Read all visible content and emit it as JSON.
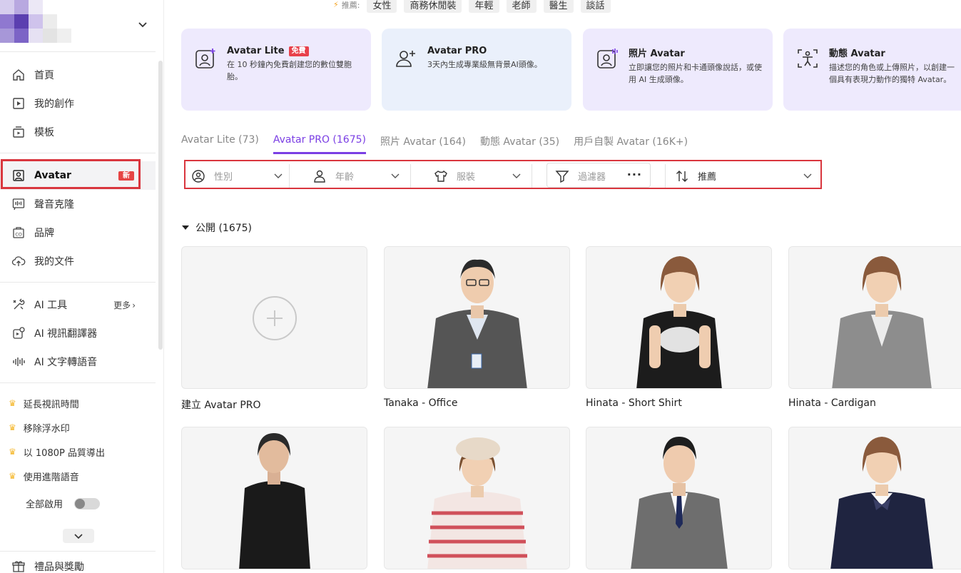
{
  "sidebar": {
    "nav": [
      {
        "label": "首頁"
      },
      {
        "label": "我的創作"
      },
      {
        "label": "模板"
      }
    ],
    "avatar_item": {
      "label": "Avatar",
      "badge": "新"
    },
    "nav2": [
      {
        "label": "聲音克隆"
      },
      {
        "label": "品牌"
      },
      {
        "label": "我的文件"
      }
    ],
    "ai_tools": {
      "label": "AI 工具",
      "more": "更多"
    },
    "ai_items": [
      {
        "label": "AI 視訊翻譯器"
      },
      {
        "label": "AI 文字轉語音"
      }
    ],
    "premium": [
      {
        "label": "延長視訊時間"
      },
      {
        "label": "移除浮水印"
      },
      {
        "label": "以 1080P 品質導出"
      },
      {
        "label": "使用進階語音"
      }
    ],
    "enable_all": "全部啟用",
    "rewards": "禮品與獎勵"
  },
  "recommend": {
    "label": "推薦:",
    "chips": [
      "女性",
      "商務休閒裝",
      "年輕",
      "老師",
      "醫生",
      "談話"
    ]
  },
  "cards": [
    {
      "title": "Avatar Lite",
      "badge": "免費",
      "desc": "在 10 秒鐘內免費創建您的數位雙胞胎。"
    },
    {
      "title": "Avatar PRO",
      "desc": "3天內生成專業級無背景AI頭像。"
    },
    {
      "title": "照片 Avatar",
      "desc": "立即讓您的照片和卡通頭像說話，或使用 AI 生成頭像。"
    },
    {
      "title": "動態 Avatar",
      "desc": "描述您的角色或上傳照片，以創建一個具有表現力動作的獨特 Avatar。"
    }
  ],
  "tabs": [
    {
      "label": "Avatar Lite (73)"
    },
    {
      "label": "Avatar PRO (1675)",
      "active": true
    },
    {
      "label": "照片 Avatar (164)"
    },
    {
      "label": "動態 Avatar (35)"
    },
    {
      "label": "用戶自製 Avatar (16K+)"
    }
  ],
  "filters": {
    "gender": "性別",
    "age": "年齡",
    "outfit": "服裝",
    "filter": "過濾器",
    "sort": "推薦"
  },
  "section": {
    "label": "公開 (1675)"
  },
  "avatars_row1": [
    {
      "label": "建立 Avatar PRO"
    },
    {
      "label": "Tanaka - Office",
      "shirt": "#4a4a4a",
      "hair": "#2b2b2b"
    },
    {
      "label": "Hinata - Short Shirt",
      "shirt": "#1c1c1c",
      "hair": "#8a5a3c"
    },
    {
      "label": "Hinata - Cardigan",
      "shirt": "#8d8d8d",
      "hair": "#8a5a3c"
    }
  ],
  "avatars_row2": [
    {
      "shirt": "#1a1a1a",
      "hair": "#2a2a2a"
    },
    {
      "shirt": "#e8d6d0",
      "hair": "#7a5030"
    },
    {
      "shirt": "#6e6e6e",
      "hair": "#1e1e1e"
    },
    {
      "shirt": "#1f2440",
      "hair": "#8a5a3c"
    }
  ],
  "colors": {
    "accent": "#7b3fe4",
    "highlight": "#d9363e",
    "card_bg": "#eeeafd"
  }
}
